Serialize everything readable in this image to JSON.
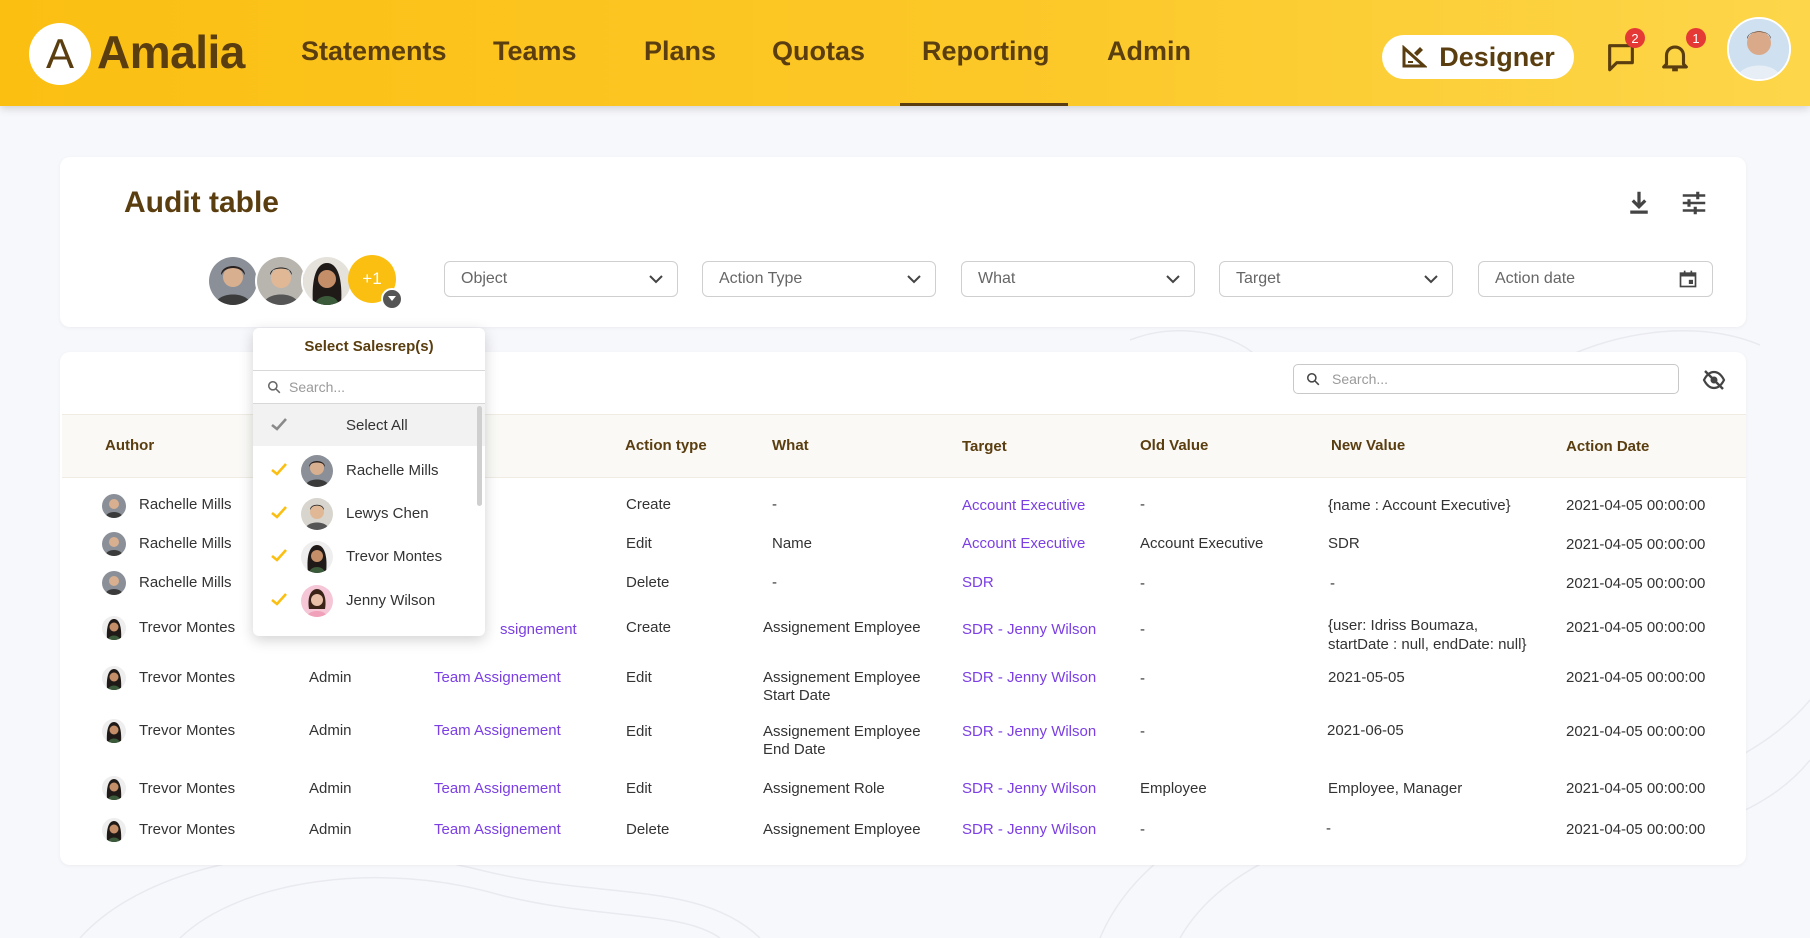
{
  "app": {
    "logo_letter": "A",
    "name": "Amalia"
  },
  "nav": {
    "items": [
      "Statements",
      "Teams",
      "Plans",
      "Quotas",
      "Reporting",
      "Admin"
    ],
    "active": "Reporting"
  },
  "header": {
    "designer_label": "Designer",
    "messages_badge": "2",
    "notifications_badge": "1"
  },
  "page": {
    "title": "Audit table"
  },
  "filters": {
    "avatars_more": "+1",
    "object": "Object",
    "action_type": "Action Type",
    "what": "What",
    "target": "Target",
    "action_date": "Action date"
  },
  "table_search": {
    "placeholder": "Search..."
  },
  "columns": {
    "author": "Author",
    "action_type": "Action type",
    "what": "What",
    "target": "Target",
    "old_value": "Old Value",
    "new_value": "New Value",
    "action_date": "Action Date"
  },
  "rows": [
    {
      "author": "Rachelle Mills",
      "role": "",
      "object": "",
      "action": "Create",
      "what": "-",
      "target": "Account Executive",
      "old": "-",
      "new": "{name : Account Executive}",
      "new2": "",
      "date": "2021-04-05 00:00:00",
      "what2": ""
    },
    {
      "author": "Rachelle Mills",
      "role": "",
      "object": "",
      "action": "Edit",
      "what": "Name",
      "target": "Account Executive",
      "old": "Account Executive",
      "new": "SDR",
      "new2": "",
      "date": "2021-04-05 00:00:00",
      "what2": ""
    },
    {
      "author": "Rachelle Mills",
      "role": "",
      "object": "",
      "action": "Delete",
      "what": "-",
      "target": "SDR",
      "old": "-",
      "new": "-",
      "new2": "",
      "date": "2021-04-05 00:00:00",
      "what2": ""
    },
    {
      "author": "Trevor Montes",
      "role": "",
      "object": "ssignement",
      "action": "Create",
      "what": "Assignement Employee",
      "target": "SDR - Jenny Wilson",
      "old": "-",
      "new": "{user: Idriss Boumaza,",
      "new2": "startDate : null, endDate: null}",
      "date": "2021-04-05 00:00:00",
      "what2": ""
    },
    {
      "author": "Trevor Montes",
      "role": "Admin",
      "object": "Team Assignement",
      "action": "Edit",
      "what": "Assignement Employee",
      "target": "SDR - Jenny Wilson",
      "old": "-",
      "new": "2021-05-05",
      "new2": "",
      "date": "2021-04-05 00:00:00",
      "what2": "Start Date"
    },
    {
      "author": "Trevor Montes",
      "role": "Admin",
      "object": "Team Assignement",
      "action": "Edit",
      "what": "Assignement Employee",
      "target": "SDR - Jenny Wilson",
      "old": "-",
      "new": "2021-06-05",
      "new2": "",
      "date": "2021-04-05 00:00:00",
      "what2": "End Date"
    },
    {
      "author": "Trevor Montes",
      "role": "Admin",
      "object": "Team Assignement",
      "action": "Edit",
      "what": "Assignement Role",
      "target": "SDR - Jenny Wilson",
      "old": "Employee",
      "new": "Employee, Manager",
      "new2": "",
      "date": "2021-04-05 00:00:00",
      "what2": ""
    },
    {
      "author": "Trevor Montes",
      "role": "Admin",
      "object": "Team Assignement",
      "action": "Delete",
      "what": "Assignement Employee",
      "target": "SDR - Jenny Wilson",
      "old": "-",
      "new": "-",
      "new2": "",
      "date": "2021-04-05 00:00:00",
      "what2": ""
    }
  ],
  "salesrep_dropdown": {
    "title": "Select Salesrep(s)",
    "search_placeholder": "Search...",
    "select_all": "Select All",
    "items": [
      "Rachelle Mills",
      "Lewys Chen",
      "Trevor Montes",
      "Jenny Wilson"
    ]
  },
  "colors": {
    "brand": "#fbbf12",
    "brand_text": "#5a3e10",
    "link": "#7b3fe4",
    "check": "#fbbf12"
  }
}
